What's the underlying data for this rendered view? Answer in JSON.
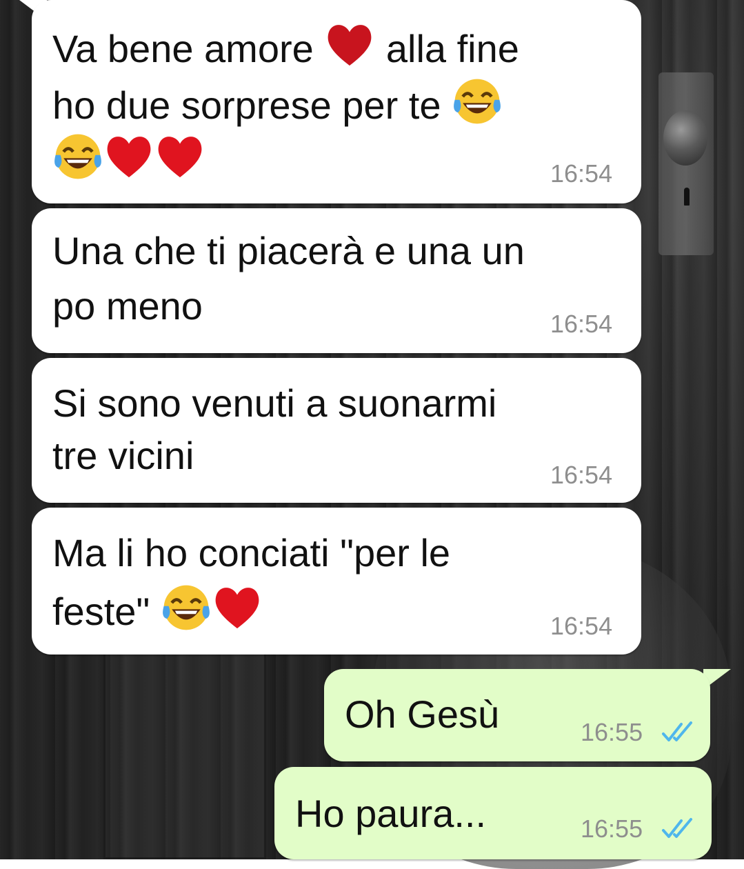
{
  "chat": {
    "incoming": [
      {
        "line1_a": "Va bene amore",
        "line1_b": "alla fine",
        "line2": "ho due sorprese per te",
        "time": "16:54",
        "emojis": [
          "red-heart",
          "face-with-tears-of-joy",
          "face-with-tears-of-joy",
          "red-heart",
          "red-heart"
        ]
      },
      {
        "line1": "Una che ti piacerà e una un",
        "line2": "po meno",
        "time": "16:54"
      },
      {
        "line1": "Si sono venuti a suonarmi",
        "line2": "tre vicini",
        "time": "16:54"
      },
      {
        "line1": "Ma li ho conciati \"per le",
        "line2": "feste\"",
        "time": "16:54",
        "emojis": [
          "face-with-tears-of-joy",
          "red-heart"
        ]
      }
    ],
    "outgoing": [
      {
        "text": "Oh Gesù",
        "time": "16:55",
        "status": "read"
      },
      {
        "text": "Ho paura...",
        "time": "16:55",
        "status": "read"
      }
    ]
  },
  "colors": {
    "incoming_bubble": "#ffffff",
    "outgoing_bubble": "#e2fdc8",
    "read_ticks": "#4fb6ec",
    "timestamp": "#8e8e8e"
  }
}
